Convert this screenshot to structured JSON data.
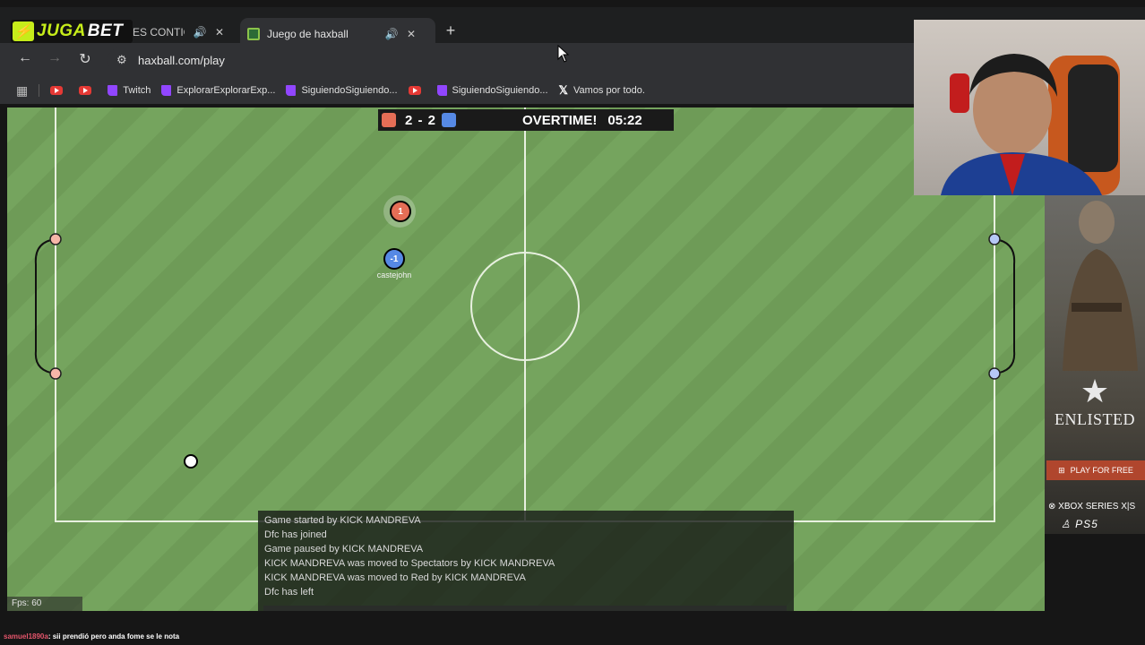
{
  "browser": {
    "brand_left": "JUGA",
    "brand_right": "BET",
    "tabs": [
      {
        "title": "ES CONTIGO"
      },
      {
        "title": "Juego de haxball"
      }
    ],
    "url": "haxball.com/play"
  },
  "bookmarks": [
    {
      "label": "",
      "icon": "youtube-icon"
    },
    {
      "label": "",
      "icon": "youtube-icon"
    },
    {
      "label": "Twitch",
      "icon": "twitch-icon"
    },
    {
      "label": "ExplorarExplorarExp...",
      "icon": "twitch-icon"
    },
    {
      "label": "SiguiendoSiguiendo...",
      "icon": "twitch-icon"
    },
    {
      "label": "",
      "icon": "youtube-icon"
    },
    {
      "label": "SiguiendoSiguiendo...",
      "icon": "twitch-icon"
    },
    {
      "label": "Vamos por todo.",
      "icon": "x-icon"
    }
  ],
  "game": {
    "score": "2 - 2",
    "status": "OVERTIME!",
    "time": "05:22",
    "players": [
      {
        "number": "1",
        "team": "red",
        "name": ""
      },
      {
        "number": "-1",
        "team": "blue",
        "name": "castejohn"
      }
    ],
    "chat": [
      "Game started by KICK MANDREVA",
      "Dfc has joined",
      "Game paused by KICK MANDREVA",
      "KICK MANDREVA was moved to Spectators by KICK MANDREVA",
      "KICK MANDREVA was moved to Red by KICK MANDREVA",
      "Dfc has left"
    ],
    "fps": "Fps: 60",
    "colors": {
      "red": "#e56e56",
      "blue": "#5689e5",
      "pitch": "#75a45e"
    }
  },
  "ad": {
    "title": "ENLISTED",
    "cta": "PLAY FOR FREE",
    "platforms": "XBOX SERIES X|S",
    "platforms2": "PS5"
  },
  "stream_chat": {
    "user": "samuel1890a",
    "message": ": sii prendió pero anda fome se le nota"
  }
}
